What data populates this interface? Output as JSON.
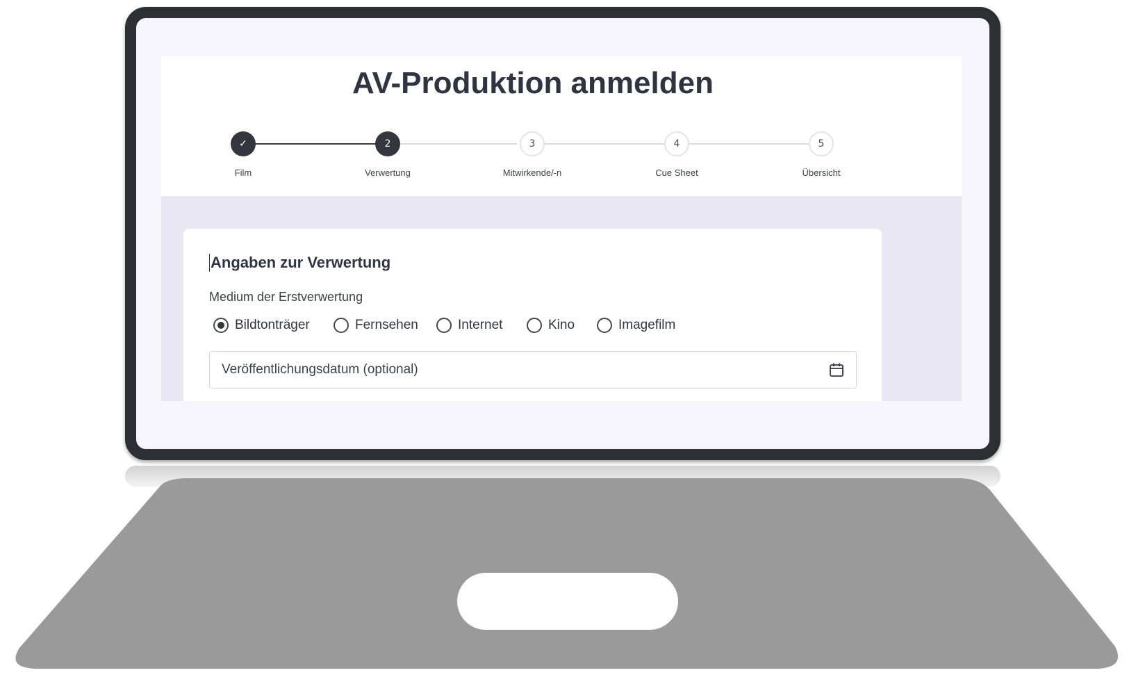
{
  "page": {
    "title": "AV-Produktion anmelden"
  },
  "stepper": {
    "steps": [
      {
        "number": "✓",
        "label": "Film",
        "state": "completed"
      },
      {
        "number": "2",
        "label": "Verwertung",
        "state": "active"
      },
      {
        "number": "3",
        "label": "Mitwirkende/-n",
        "state": "pending"
      },
      {
        "number": "4",
        "label": "Cue Sheet",
        "state": "pending"
      },
      {
        "number": "5",
        "label": "Übersicht",
        "state": "pending"
      }
    ]
  },
  "form": {
    "section_title": "Angaben zur Verwertung",
    "medium_label": "Medium der Erstverwertung",
    "medium_options": [
      {
        "label": "Bildtonträger",
        "selected": true
      },
      {
        "label": "Fernsehen",
        "selected": false
      },
      {
        "label": "Internet",
        "selected": false
      },
      {
        "label": "Kino",
        "selected": false
      },
      {
        "label": "Imagefilm",
        "selected": false
      }
    ],
    "release_date": {
      "placeholder": "Veröffentlichungsdatum (optional)",
      "value": "",
      "icon": "calendar-icon"
    }
  },
  "colors": {
    "dark": "#33363d",
    "screen_bg": "#e9e8f2",
    "laptop_frame": "#2d2f33",
    "laptop_base": "#9a9a9a"
  }
}
